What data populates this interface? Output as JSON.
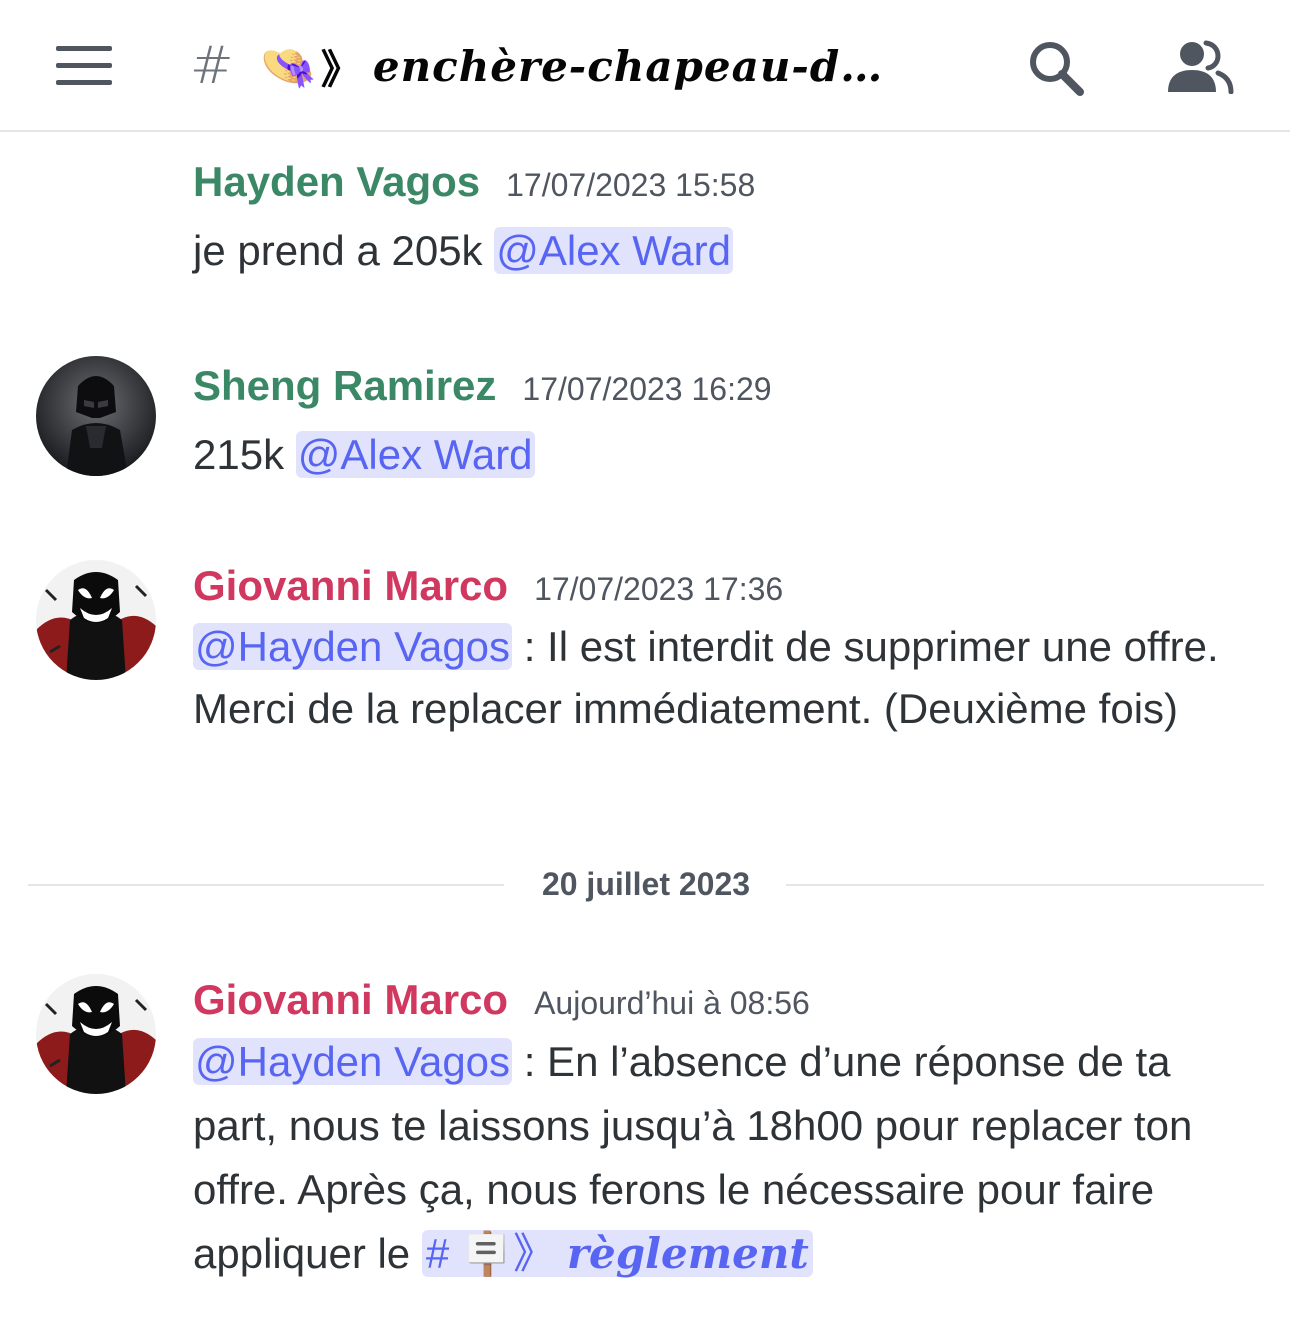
{
  "header": {
    "channel_hash": "#",
    "channel_emoji": "👒",
    "channel_separator": "》",
    "channel_name": "enchère-chapeau-d…"
  },
  "messages": [
    {
      "author": "Hayden Vagos",
      "timestamp": "17/07/2023 15:58",
      "text": "je prend a 205k ",
      "mention": "@Alex Ward"
    },
    {
      "author": "Sheng Ramirez",
      "timestamp": "17/07/2023 16:29",
      "text": "215k ",
      "mention": "@Alex Ward"
    },
    {
      "author": "Giovanni Marco",
      "timestamp": "17/07/2023 17:36",
      "mention": "@Hayden Vagos",
      "text": " : Il est interdit de supprimer une offre. Merci de la replacer immédiatement. (Deuxième fois)"
    },
    {
      "author": "Giovanni Marco",
      "timestamp": "Aujourd’hui à 08:56",
      "mention": "@Hayden Vagos",
      "text": " : En l’absence d’une réponse de ta part, nous te laissons jusqu’à 18h00 pour replacer ton offre. Après ça, nous ferons le nécessaire pour faire appliquer le ",
      "channel_link": {
        "hash": "#",
        "emoji": "🪧",
        "separator": "》",
        "name": "règlement"
      }
    }
  ],
  "date_divider": "20 juillet 2023",
  "colors": {
    "green_role": "#3b8866",
    "pink_role": "#d1385f",
    "mention_fg": "#5865f2",
    "mention_bg": "#e0e3fb"
  },
  "icons": {
    "menu": "hamburger-menu-icon",
    "search": "search-icon",
    "members": "members-icon"
  }
}
